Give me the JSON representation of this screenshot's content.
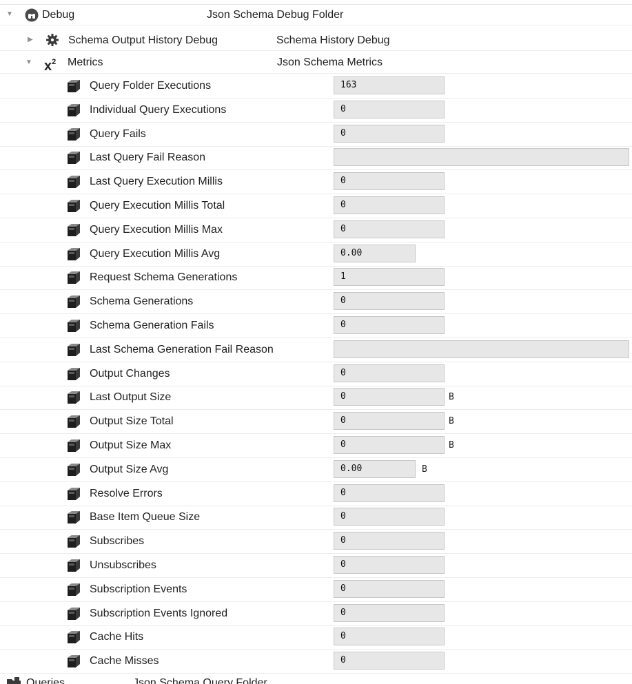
{
  "tree": {
    "debug": {
      "label": "Debug",
      "type": "Json Schema Debug Folder",
      "icon": "binoculars-icon"
    },
    "history": {
      "label": "Schema Output History Debug",
      "type": "Schema History Debug",
      "icon": "gear-icon"
    },
    "metrics": {
      "label": "Metrics",
      "type": "Json Schema Metrics",
      "icon": "x-squared-icon"
    },
    "queries": {
      "label": "Queries",
      "type": "Json Schema Query Folder",
      "icon": "folder-icon"
    }
  },
  "properties": [
    {
      "label": "Query Folder Executions",
      "value": "163"
    },
    {
      "label": "Individual Query Executions",
      "value": "0"
    },
    {
      "label": "Query Fails",
      "value": "0"
    },
    {
      "label": "Last Query Fail Reason",
      "value": ""
    },
    {
      "label": "Last Query Execution Millis",
      "value": "0"
    },
    {
      "label": "Query Execution Millis Total",
      "value": "0"
    },
    {
      "label": "Query Execution Millis Max",
      "value": "0"
    },
    {
      "label": "Query Execution Millis Avg",
      "value": "0.00"
    },
    {
      "label": "Request Schema Generations",
      "value": "1"
    },
    {
      "label": "Schema Generations",
      "value": "0"
    },
    {
      "label": "Schema Generation Fails",
      "value": "0"
    },
    {
      "label": "Last Schema Generation Fail Reason",
      "value": ""
    },
    {
      "label": "Output Changes",
      "value": "0"
    },
    {
      "label": "Last Output Size",
      "value": "0",
      "unit": "B"
    },
    {
      "label": "Output Size Total",
      "value": "0",
      "unit": "B"
    },
    {
      "label": "Output Size Max",
      "value": "0",
      "unit": "B"
    },
    {
      "label": "Output Size Avg",
      "value": "0.00",
      "unit": "B"
    },
    {
      "label": "Resolve Errors",
      "value": "0"
    },
    {
      "label": "Base Item Queue Size",
      "value": "0"
    },
    {
      "label": "Subscribes",
      "value": "0"
    },
    {
      "label": "Unsubscribes",
      "value": "0"
    },
    {
      "label": "Subscription Events",
      "value": "0"
    },
    {
      "label": "Subscription Events Ignored",
      "value": "0"
    },
    {
      "label": "Cache Hits",
      "value": "0"
    },
    {
      "label": "Cache Misses",
      "value": "0"
    }
  ],
  "property_icon": "slot-cube-icon"
}
